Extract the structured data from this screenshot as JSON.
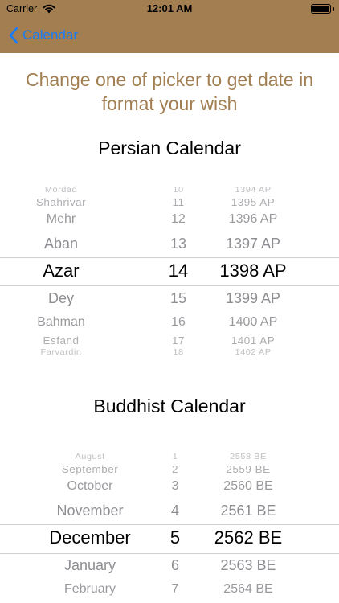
{
  "status_bar": {
    "carrier": "Carrier",
    "time": "12:01 AM"
  },
  "nav": {
    "back_label": "Calendar"
  },
  "instruction": "Change one of picker to get date in format your wish",
  "colors": {
    "header": "#a27e51",
    "link": "#1a7cf5",
    "accent_text": "#a27e51"
  },
  "persian": {
    "title": "Persian Calendar",
    "rows": [
      {
        "month": "Mordad",
        "day": "10",
        "year": "1394 AP"
      },
      {
        "month": "Shahrivar",
        "day": "11",
        "year": "1395 AP"
      },
      {
        "month": "Mehr",
        "day": "12",
        "year": "1396 AP"
      },
      {
        "month": "Aban",
        "day": "13",
        "year": "1397 AP"
      },
      {
        "month": "Azar",
        "day": "14",
        "year": "1398 AP"
      },
      {
        "month": "Dey",
        "day": "15",
        "year": "1399 AP"
      },
      {
        "month": "Bahman",
        "day": "16",
        "year": "1400 AP"
      },
      {
        "month": "Esfand",
        "day": "17",
        "year": "1401 AP"
      },
      {
        "month": "Farvardin",
        "day": "18",
        "year": "1402 AP"
      }
    ],
    "selected_index": 4
  },
  "buddhist": {
    "title": "Buddhist Calendar",
    "rows": [
      {
        "month": "August",
        "day": "1",
        "year": "2558 BE"
      },
      {
        "month": "September",
        "day": "2",
        "year": "2559 BE"
      },
      {
        "month": "October",
        "day": "3",
        "year": "2560 BE"
      },
      {
        "month": "November",
        "day": "4",
        "year": "2561 BE"
      },
      {
        "month": "December",
        "day": "5",
        "year": "2562 BE"
      },
      {
        "month": "January",
        "day": "6",
        "year": "2563 BE"
      },
      {
        "month": "February",
        "day": "7",
        "year": "2564 BE"
      }
    ],
    "selected_index": 4
  }
}
